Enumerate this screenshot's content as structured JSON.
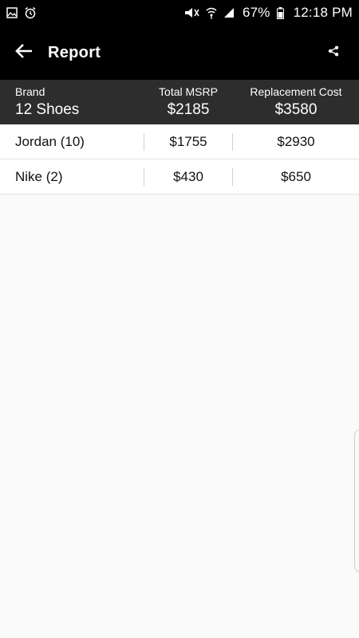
{
  "status_bar": {
    "battery_percent": "67%",
    "time": "12:18 PM",
    "icons": [
      "image-icon",
      "alarm-icon",
      "mute-icon",
      "wifi-icon",
      "signal-icon",
      "battery-icon"
    ]
  },
  "app_bar": {
    "title": "Report",
    "back_icon": "arrow-back-icon",
    "share_icon": "share-icon"
  },
  "summary": {
    "brand_label": "Brand",
    "brand_value": "12 Shoes",
    "msrp_label": "Total MSRP",
    "msrp_value": "$2185",
    "replacement_label": "Replacement Cost",
    "replacement_value": "$3580"
  },
  "rows": [
    {
      "brand": "Jordan (10)",
      "msrp": "$1755",
      "replacement": "$2930"
    },
    {
      "brand": "Nike (2)",
      "msrp": "$430",
      "replacement": "$650"
    }
  ],
  "colors": {
    "app_bar_bg": "#000000",
    "summary_bg": "#2d2d2d",
    "page_bg": "#fafafa"
  }
}
